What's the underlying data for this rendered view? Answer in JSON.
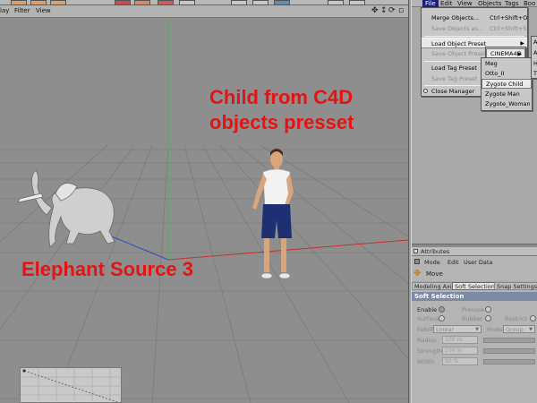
{
  "viewport": {
    "menu": [
      "lay",
      "Filter",
      "View"
    ],
    "overlays": {
      "child_line1": "Child from C4D",
      "child_line2": "objects presset",
      "elephant": "Elephant Source 3"
    }
  },
  "object_manager": {
    "menu": [
      "File",
      "Edit",
      "View",
      "Objects",
      "Tags",
      "Boo"
    ],
    "file_menu": {
      "merge_objects": {
        "label": "Merge Objects...",
        "shortcut": "Ctrl+Shift+O"
      },
      "save_objects_as": {
        "label": "Save Objects as...",
        "shortcut": "Ctrl+Shift+S"
      },
      "load_object_preset": {
        "label": "Load Object Preset"
      },
      "save_object_preset": {
        "label": "Save Object Preset"
      },
      "load_tag_preset": {
        "label": "Load Tag Preset"
      },
      "save_tag_preset": {
        "label": "Save Tag Preset"
      },
      "close_manager": {
        "label": "Close Manager"
      }
    },
    "preset_submenu": {
      "cinema4d": "CINEMA4D"
    },
    "cinema4d_submenu": [
      "Meg",
      "Otto_II",
      "Zygote Child",
      "Zygote Man",
      "Zygote_Woman"
    ],
    "stub_letters": [
      "A",
      "A",
      "H",
      "T"
    ]
  },
  "attributes": {
    "title": "Attributes",
    "menu": [
      "Mode",
      "Edit",
      "User Data"
    ],
    "tool_name": "Move",
    "tabs": [
      "Modeling Axis",
      "Soft Selection",
      "Snap Settings"
    ],
    "section": "Soft Selection",
    "fields": {
      "enable": "Enable",
      "preview": "Preview",
      "surface": "Surface",
      "rubber": "Rubber",
      "restrict": "Restrict",
      "falloff": "Falloff",
      "falloff_value": "Linear",
      "mode": "Mode",
      "mode_value": "Group",
      "radius": "Radius",
      "radius_value": "100 m",
      "strength": "Strength",
      "strength_value": "100 %",
      "width": "Width",
      "width_value": "50 %"
    }
  }
}
